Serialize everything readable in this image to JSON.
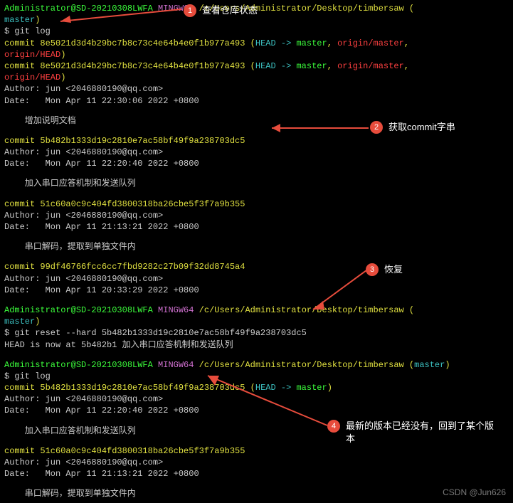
{
  "prompt_user": "Administrator@SD-20210308LWFA",
  "prompt_shell": "MINGW64",
  "prompt_path": "/c/Users/Administrator/Desktop/timbersaw",
  "branch": "master",
  "cmd_gitlog": "$ git log",
  "commit1_hash": "commit 8e5021d3d4b29bc7b8c73c4e64b4e0f1b977a493",
  "commit1_ref": " (",
  "commit1_head": "HEAD -> ",
  "commit1_master": "master",
  "commit1_sep": ", ",
  "commit1_origin_master": "origin/master",
  "commit1_origin_head_line": "origin/HEAD",
  "commit1_close": ")",
  "author_line": "Author: jun <2046880190@qq.com>",
  "date1": "Date:   Mon Apr 11 22:30:06 2022 +0800",
  "msg1": "    增加说明文档",
  "commit2_hash": "commit 5b482b1333d19c2810e7ac58bf49f9a238703dc5",
  "date2": "Date:   Mon Apr 11 22:20:40 2022 +0800",
  "msg2": "    加入串口应答机制和发送队列",
  "commit3_hash": "commit 51c60a0c9c404fd3800318ba26cbe5f3f7a9b355",
  "date3": "Date:   Mon Apr 11 21:13:21 2022 +0800",
  "msg3": "    串口解码，提取到单独文件内",
  "commit4_hash": "commit 99df46766fcc6cc7fbd9282c27b09f32dd8745a4",
  "date4": "Date:   Mon Apr 11 20:33:29 2022 +0800",
  "cmd_reset": "$ git reset --hard 5b482b1333d19c2810e7ac58bf49f9a238703dc5",
  "reset_output": "HEAD is now at 5b482b1 加入串口应答机制和发送队列",
  "commit2b_ref": " (",
  "commit2b_head": "HEAD -> ",
  "commit2b_master": "master",
  "commit2b_close": ")",
  "annot1_num": "1",
  "annot1_text": "查看仓库状态",
  "annot2_num": "2",
  "annot2_text": "获取commit字串",
  "annot3_num": "3",
  "annot3_text": "恢复",
  "annot4_num": "4",
  "annot4_text": "最新的版本已经没有，回到了某个版本",
  "watermark": "CSDN @Jun626"
}
